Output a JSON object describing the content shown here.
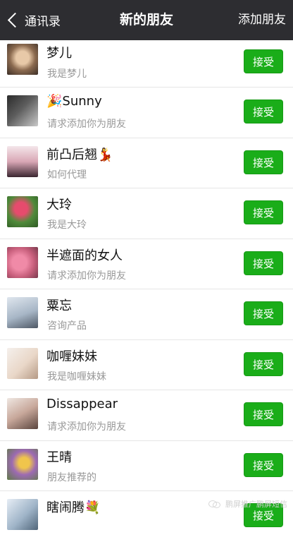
{
  "header": {
    "back_label": "通讯录",
    "title": "新的朋友",
    "action_label": "添加朋友"
  },
  "requests": [
    {
      "name": "梦儿",
      "message": "我是梦儿",
      "button": "接受"
    },
    {
      "name": "🎉Sunny",
      "message": "请求添加你为朋友",
      "button": "接受"
    },
    {
      "name": "前凸后翘💃",
      "message": "如何代理",
      "button": "接受"
    },
    {
      "name": "大玲",
      "message": "我是大玲",
      "button": "接受"
    },
    {
      "name": "半遮面的女人",
      "message": "请求添加你为朋友",
      "button": "接受"
    },
    {
      "name": "粟忘",
      "message": "咨询产品",
      "button": "接受"
    },
    {
      "name": "咖喱妹妹",
      "message": "我是咖喱妹妹",
      "button": "接受"
    },
    {
      "name": "Dissappear",
      "message": "请求添加你为朋友",
      "button": "接受"
    },
    {
      "name": "王晴",
      "message": "朋友推荐的",
      "button": "接受"
    },
    {
      "name": "瞎闹腾💐",
      "message": "",
      "button": "接受"
    }
  ],
  "watermark": "鹏屏推广鹏屏短信",
  "colors": {
    "navbar": "#2d2d31",
    "accept_green": "#1aad19",
    "subtext": "#999999"
  }
}
